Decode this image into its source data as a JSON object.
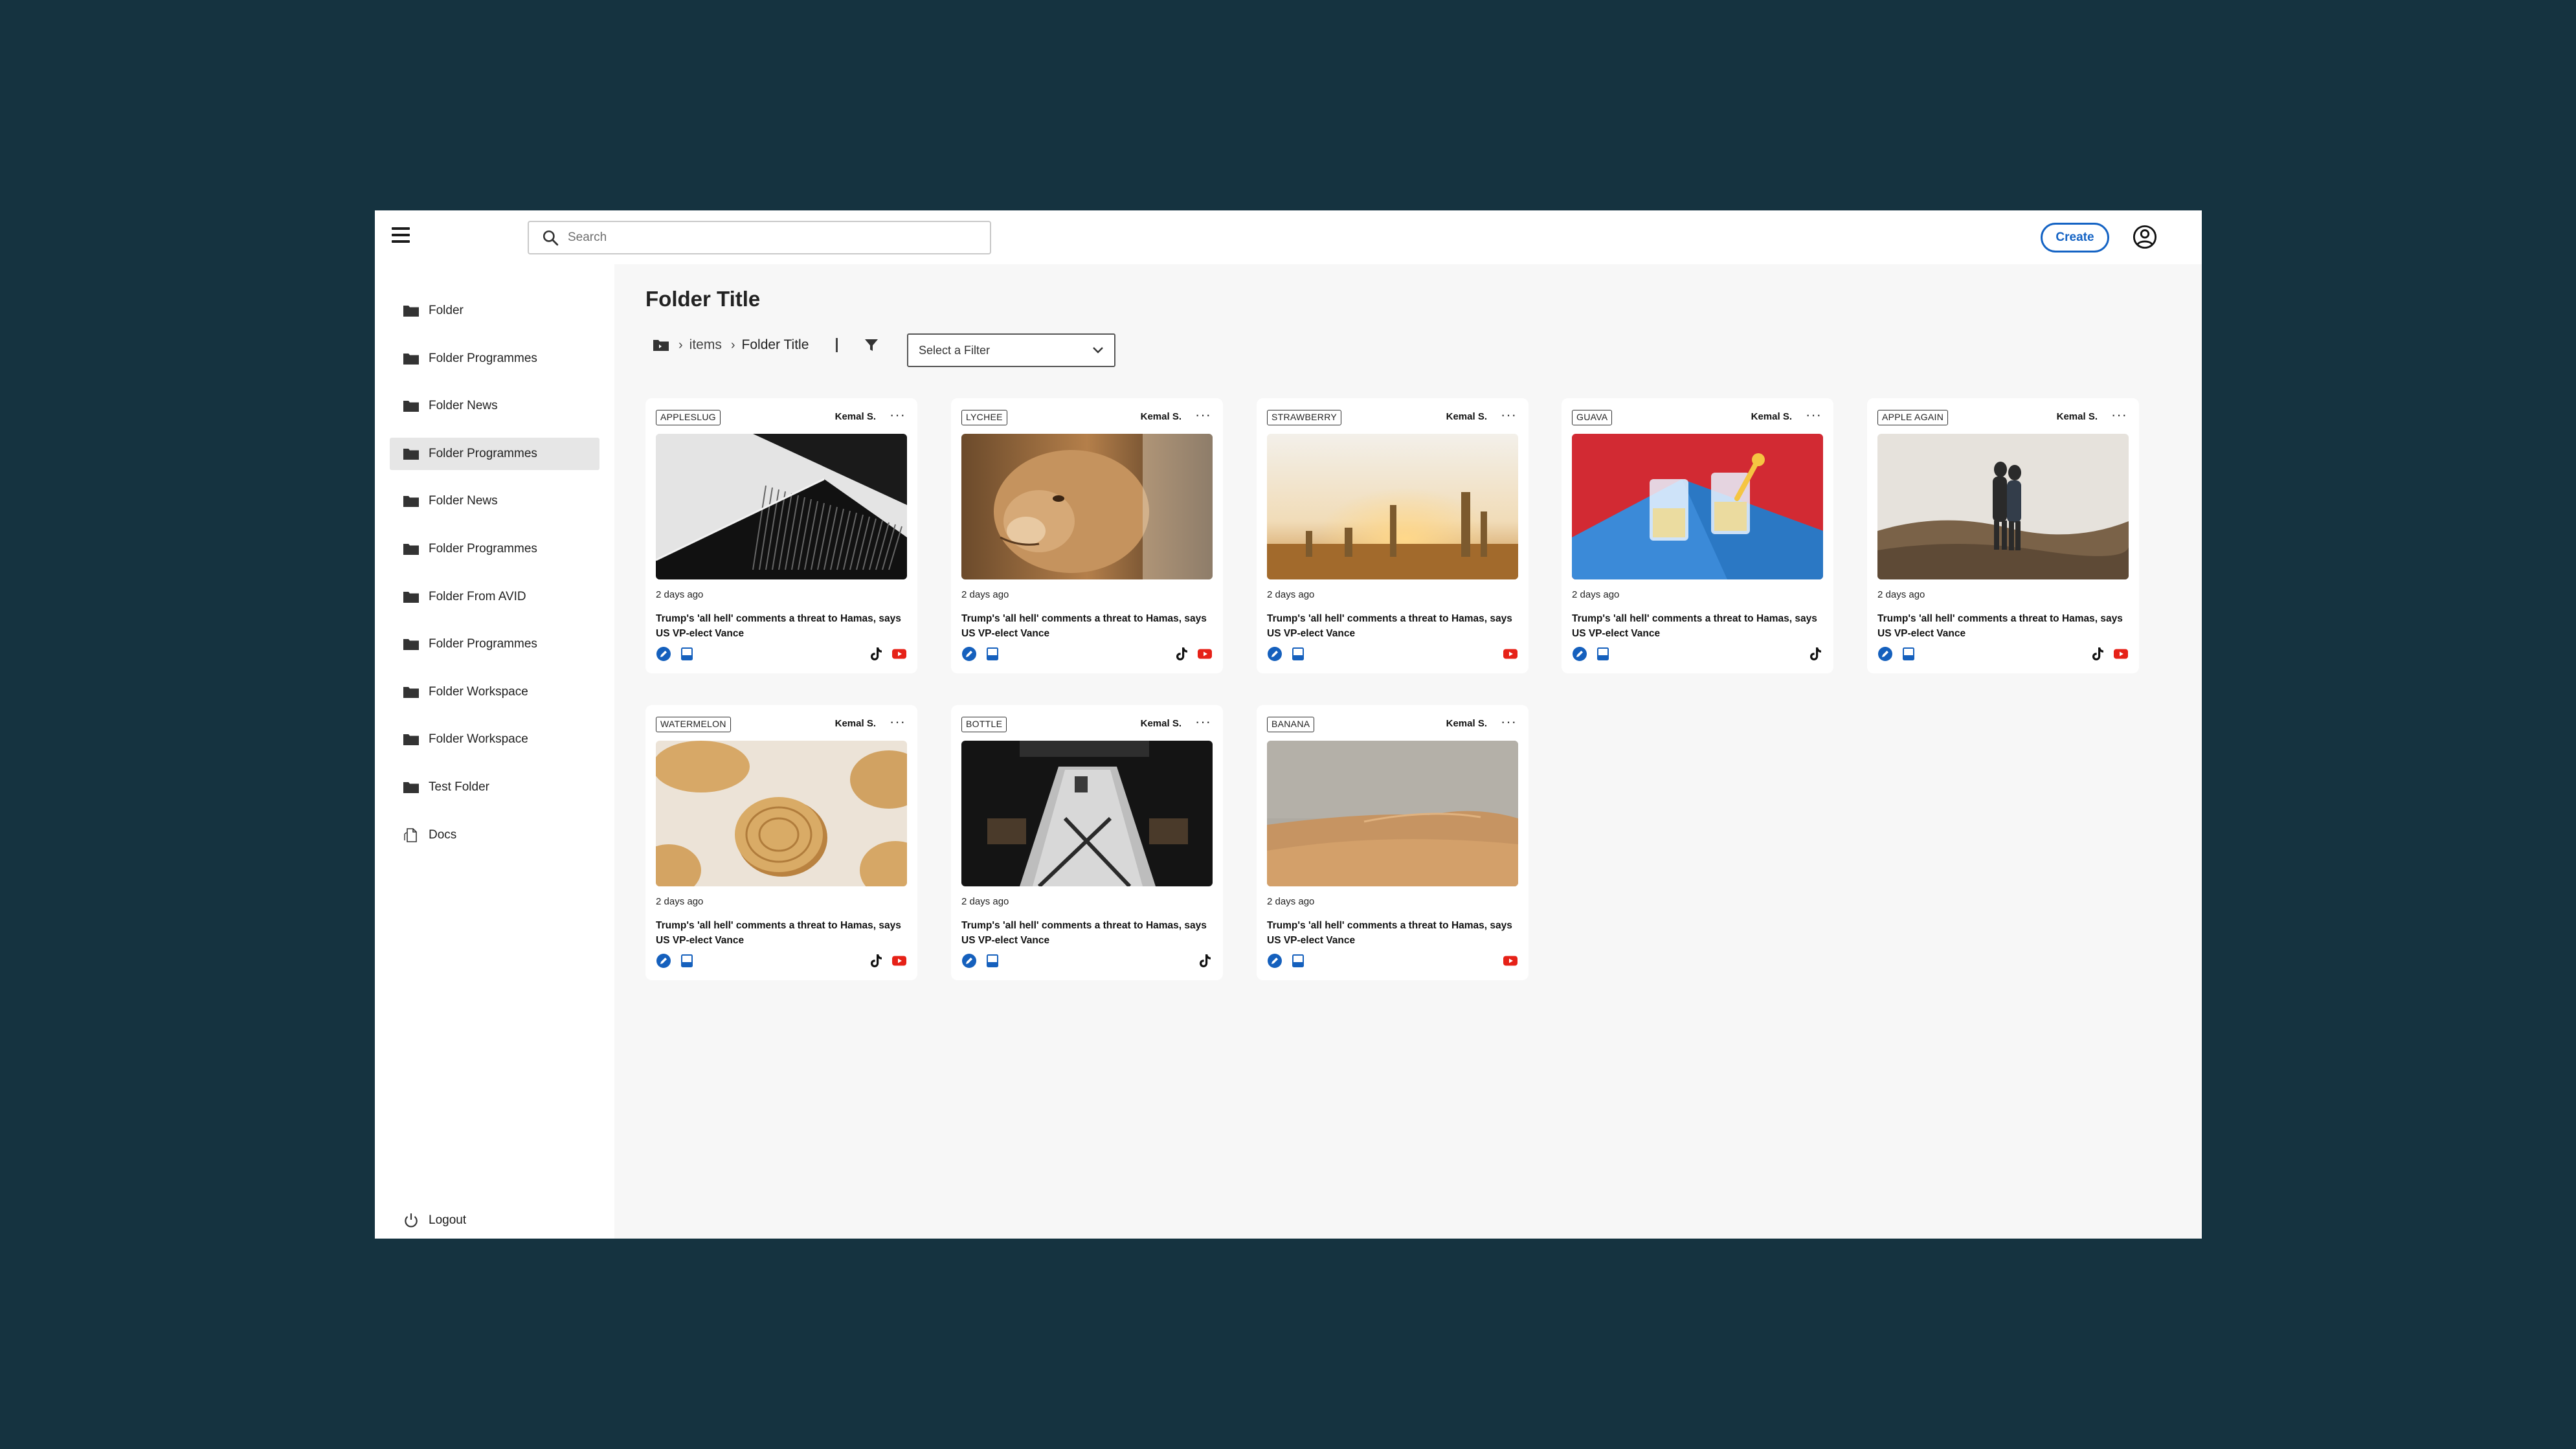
{
  "topbar": {
    "menu_icon": "hamburger-icon",
    "search_placeholder": "Search",
    "create_label": "Create",
    "user_icon": "account-circle-icon"
  },
  "sidebar": {
    "items": [
      {
        "label": "Folder",
        "icon": "folder-icon"
      },
      {
        "label": "Folder Programmes",
        "icon": "folder-icon"
      },
      {
        "label": "Folder News",
        "icon": "folder-icon"
      },
      {
        "label": "Folder Programmes",
        "icon": "folder-icon",
        "active": true
      },
      {
        "label": "Folder News",
        "icon": "folder-icon"
      },
      {
        "label": "Folder Programmes",
        "icon": "folder-icon"
      },
      {
        "label": "Folder From AVID",
        "icon": "folder-icon"
      },
      {
        "label": "Folder Programmes",
        "icon": "folder-icon"
      },
      {
        "label": "Folder Workspace",
        "icon": "folder-icon"
      },
      {
        "label": "Folder Workspace",
        "icon": "folder-icon"
      },
      {
        "label": "Test Folder",
        "icon": "folder-icon"
      },
      {
        "label": "Docs",
        "icon": "document-icon"
      }
    ],
    "logout_label": "Logout"
  },
  "main": {
    "title": "Folder Title",
    "breadcrumb": {
      "items_label": "items",
      "current": "Folder Title"
    },
    "filter_placeholder": "Select a Filter"
  },
  "cards": [
    {
      "tag": "APPLESLUG",
      "author": "Kemal S.",
      "time": "2 days ago",
      "headline": "Trump's 'all hell' comments a threat to Hamas, says US VP-elect Vance",
      "image": "bw-architecture",
      "tiktok": true,
      "youtube": true
    },
    {
      "tag": "LYCHEE",
      "author": "Kemal S.",
      "time": "2 days ago",
      "headline": "Trump's 'all hell' comments a threat to Hamas, says US VP-elect Vance",
      "image": "lioness",
      "tiktok": true,
      "youtube": true
    },
    {
      "tag": "STRAWBERRY",
      "author": "Kemal S.",
      "time": "2 days ago",
      "headline": "Trump's 'all hell' comments a threat to Hamas, says US VP-elect Vance",
      "image": "sunset-cypress",
      "tiktok": false,
      "youtube": true
    },
    {
      "tag": "GUAVA",
      "author": "Kemal S.",
      "time": "2 days ago",
      "headline": "Trump's 'all hell' comments a threat to Hamas, says US VP-elect Vance",
      "image": "glasses-red-blue",
      "tiktok": true,
      "youtube": false
    },
    {
      "tag": "APPLE AGAIN",
      "author": "Kemal S.",
      "time": "2 days ago",
      "headline": "Trump's 'all hell' comments a threat to Hamas, says US VP-elect Vance",
      "image": "couple-dunes",
      "tiktok": true,
      "youtube": true
    },
    {
      "tag": "WATERMELON",
      "author": "Kemal S.",
      "time": "2 days ago",
      "headline": "Trump's 'all hell' comments a threat to Hamas, says US VP-elect Vance",
      "image": "cookies",
      "tiktok": true,
      "youtube": true
    },
    {
      "tag": "BOTTLE",
      "author": "Kemal S.",
      "time": "2 days ago",
      "headline": "Trump's 'all hell' comments a threat to Hamas, says US VP-elect Vance",
      "image": "dark-dining",
      "tiktok": true,
      "youtube": false
    },
    {
      "tag": "BANANA",
      "author": "Kemal S.",
      "time": "2 days ago",
      "headline": "Trump's 'all hell' comments a threat to Hamas, says US VP-elect Vance",
      "image": "desert",
      "tiktok": false,
      "youtube": true
    }
  ],
  "colors": {
    "page_bg": "#153340",
    "accent": "#1463c4",
    "youtube": "#e62117",
    "tiktok": "#111111"
  }
}
